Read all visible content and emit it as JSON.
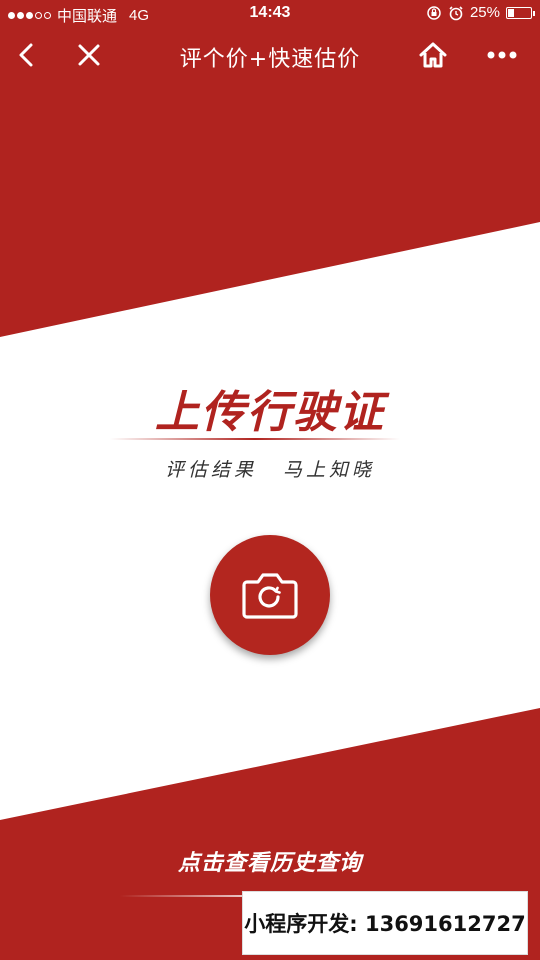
{
  "status_bar": {
    "carrier": "中国联通",
    "network": "4G",
    "time": "14:43",
    "battery_text": "25%",
    "battery_level": 0.25,
    "signal_bars_filled": 3,
    "signal_bars_total": 5
  },
  "nav": {
    "title": "评个价+快速估价",
    "back_icon": "chevron-left-icon",
    "close_icon": "close-icon",
    "home_icon": "home-icon",
    "more_icon": "more-dots-icon"
  },
  "hero": {
    "headline": "上传行驶证",
    "subline_left": "评估结果",
    "subline_right": "马上知晓",
    "camera_icon": "camera-icon"
  },
  "footer": {
    "history_link": "点击查看历史查询",
    "promo_text": "小程序开发: 13691612727"
  },
  "colors": {
    "brand_red": "#b0231f",
    "background": "#ffffff"
  }
}
